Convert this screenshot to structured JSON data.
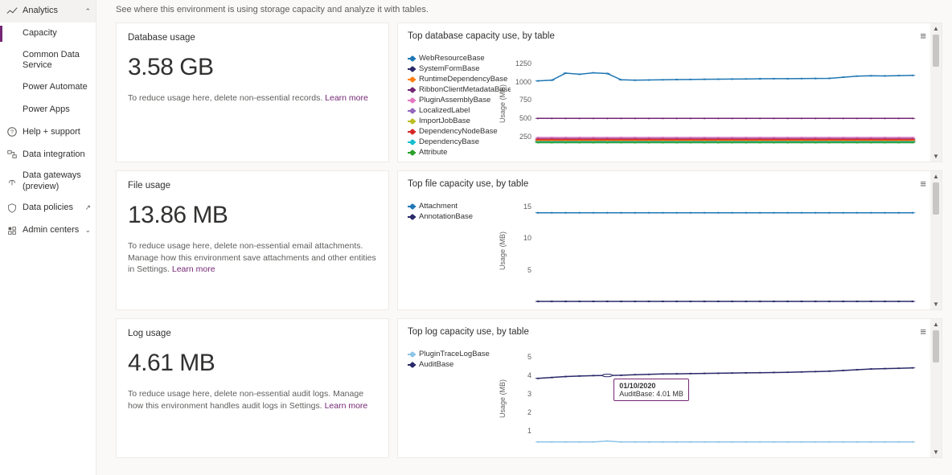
{
  "description": "See where this environment is using storage capacity and analyze it with tables.",
  "nav": {
    "analytics": "Analytics",
    "capacity": "Capacity",
    "common_data": "Common Data Service",
    "power_automate": "Power Automate",
    "power_apps": "Power Apps",
    "help": "Help + support",
    "data_integration": "Data integration",
    "data_gateways": "Data gateways (preview)",
    "data_policies": "Data policies",
    "admin_centers": "Admin centers"
  },
  "learn_more": "Learn more",
  "cards": {
    "db": {
      "title": "Database usage",
      "value": "3.58 GB",
      "hint": "To reduce usage here, delete non-essential records."
    },
    "file": {
      "title": "File usage",
      "value": "13.86 MB",
      "hint": "To reduce usage here, delete non-essential email attachments. Manage how this environment save attachments and other entities in Settings."
    },
    "log": {
      "title": "Log usage",
      "value": "4.61 MB",
      "hint": "To reduce usage here, delete non-essential audit logs. Manage how this environment handles audit logs in Settings."
    }
  },
  "charts": {
    "db": {
      "title": "Top database capacity use, by table",
      "ylabel": "Usage (MB)",
      "ylim": [
        0,
        1400
      ],
      "yticks": [
        250,
        500,
        750,
        1000,
        1250
      ],
      "series": [
        {
          "name": "WebResourceBase",
          "color": "#1f77b4",
          "values": [
            1010,
            1020,
            1115,
            1100,
            1120,
            1110,
            1025,
            1020,
            1022,
            1025,
            1028,
            1030,
            1032,
            1033,
            1035,
            1037,
            1039,
            1040,
            1040,
            1042,
            1043,
            1045,
            1060,
            1075,
            1080,
            1078,
            1082,
            1085
          ]
        },
        {
          "name": "SystemFormBase",
          "color": "#2a2a6a",
          "values": [
            195,
            195,
            195,
            195,
            195,
            195,
            195,
            195,
            195,
            195,
            195,
            195,
            195,
            195,
            195,
            195,
            195,
            195,
            195,
            195,
            195,
            195,
            195,
            195,
            195,
            195,
            195,
            195
          ]
        },
        {
          "name": "RuntimeDependencyBase",
          "color": "#ff7f0e",
          "values": [
            205,
            205,
            205,
            205,
            205,
            205,
            205,
            205,
            205,
            205,
            205,
            205,
            205,
            205,
            205,
            205,
            205,
            205,
            205,
            205,
            205,
            205,
            205,
            205,
            205,
            205,
            205,
            205
          ]
        },
        {
          "name": "RibbonClientMetadataBase",
          "color": "#742774",
          "values": [
            500,
            500,
            500,
            500,
            500,
            500,
            500,
            500,
            500,
            500,
            500,
            500,
            500,
            500,
            500,
            500,
            500,
            500,
            500,
            500,
            500,
            500,
            500,
            500,
            500,
            500,
            500,
            500
          ]
        },
        {
          "name": "PluginAssemblyBase",
          "color": "#e377c2",
          "values": [
            240,
            240,
            240,
            240,
            240,
            240,
            240,
            240,
            240,
            240,
            240,
            240,
            240,
            240,
            240,
            240,
            240,
            240,
            240,
            240,
            240,
            240,
            240,
            240,
            240,
            240,
            240,
            240
          ]
        },
        {
          "name": "LocalizedLabel",
          "color": "#9467bd",
          "values": [
            225,
            225,
            225,
            225,
            225,
            225,
            225,
            225,
            225,
            225,
            225,
            225,
            225,
            225,
            225,
            225,
            225,
            225,
            225,
            225,
            225,
            225,
            225,
            225,
            225,
            225,
            225,
            225
          ]
        },
        {
          "name": "ImportJobBase",
          "color": "#bcbd22",
          "values": [
            185,
            185,
            185,
            185,
            185,
            185,
            185,
            185,
            185,
            185,
            185,
            185,
            185,
            185,
            185,
            185,
            185,
            185,
            185,
            185,
            185,
            185,
            185,
            185,
            185,
            185,
            185,
            185
          ]
        },
        {
          "name": "DependencyNodeBase",
          "color": "#d62728",
          "values": [
            215,
            215,
            215,
            215,
            215,
            215,
            215,
            215,
            215,
            215,
            215,
            215,
            215,
            215,
            215,
            215,
            215,
            215,
            215,
            215,
            215,
            215,
            215,
            215,
            215,
            215,
            215,
            215
          ]
        },
        {
          "name": "DependencyBase",
          "color": "#17becf",
          "values": [
            178,
            178,
            178,
            178,
            178,
            178,
            178,
            178,
            178,
            178,
            178,
            178,
            178,
            178,
            178,
            178,
            178,
            178,
            178,
            178,
            178,
            178,
            178,
            178,
            178,
            178,
            178,
            178
          ]
        },
        {
          "name": "Attribute",
          "color": "#2ca02c",
          "values": [
            170,
            170,
            170,
            170,
            170,
            170,
            170,
            170,
            170,
            170,
            170,
            170,
            170,
            170,
            170,
            170,
            170,
            170,
            170,
            170,
            170,
            170,
            170,
            170,
            170,
            170,
            170,
            170
          ]
        }
      ]
    },
    "file": {
      "title": "Top file capacity use, by table",
      "ylabel": "Usage (MB)",
      "ylim": [
        0,
        16
      ],
      "yticks": [
        5,
        10,
        15
      ],
      "series": [
        {
          "name": "Attachment",
          "color": "#1f77b4",
          "values": [
            14,
            14,
            14,
            14,
            14,
            14,
            14,
            14,
            14,
            14,
            14,
            14,
            14,
            14,
            14,
            14,
            14,
            14,
            14,
            14,
            14,
            14,
            14,
            14,
            14,
            14,
            14,
            14
          ]
        },
        {
          "name": "AnnotationBase",
          "color": "#2a2a6a",
          "values": [
            0,
            0,
            0,
            0,
            0,
            0,
            0,
            0,
            0,
            0,
            0,
            0,
            0,
            0,
            0,
            0,
            0,
            0,
            0,
            0,
            0,
            0,
            0,
            0,
            0,
            0,
            0,
            0
          ]
        }
      ]
    },
    "log": {
      "title": "Top log capacity use, by table",
      "ylabel": "Usage (MB)",
      "ylim": [
        0,
        5.5
      ],
      "yticks": [
        1,
        2,
        3,
        4,
        5
      ],
      "series": [
        {
          "name": "PluginTraceLogBase",
          "color": "#8fc5e8",
          "values": [
            0.4,
            0.4,
            0.4,
            0.4,
            0.4,
            0.45,
            0.4,
            0.4,
            0.4,
            0.4,
            0.4,
            0.4,
            0.4,
            0.4,
            0.4,
            0.4,
            0.4,
            0.4,
            0.4,
            0.4,
            0.4,
            0.4,
            0.4,
            0.4,
            0.4,
            0.4,
            0.4,
            0.4
          ]
        },
        {
          "name": "AuditBase",
          "color": "#2a2a6a",
          "values": [
            3.85,
            3.9,
            3.95,
            3.98,
            4.0,
            4.01,
            4.02,
            4.05,
            4.07,
            4.09,
            4.1,
            4.11,
            4.12,
            4.13,
            4.14,
            4.15,
            4.16,
            4.17,
            4.18,
            4.2,
            4.22,
            4.24,
            4.28,
            4.32,
            4.36,
            4.38,
            4.4,
            4.42
          ]
        }
      ],
      "tooltip": {
        "date": "01/10/2020",
        "text": "AuditBase: 4.01 MB",
        "series": "AuditBase",
        "x_index": 5
      }
    }
  }
}
